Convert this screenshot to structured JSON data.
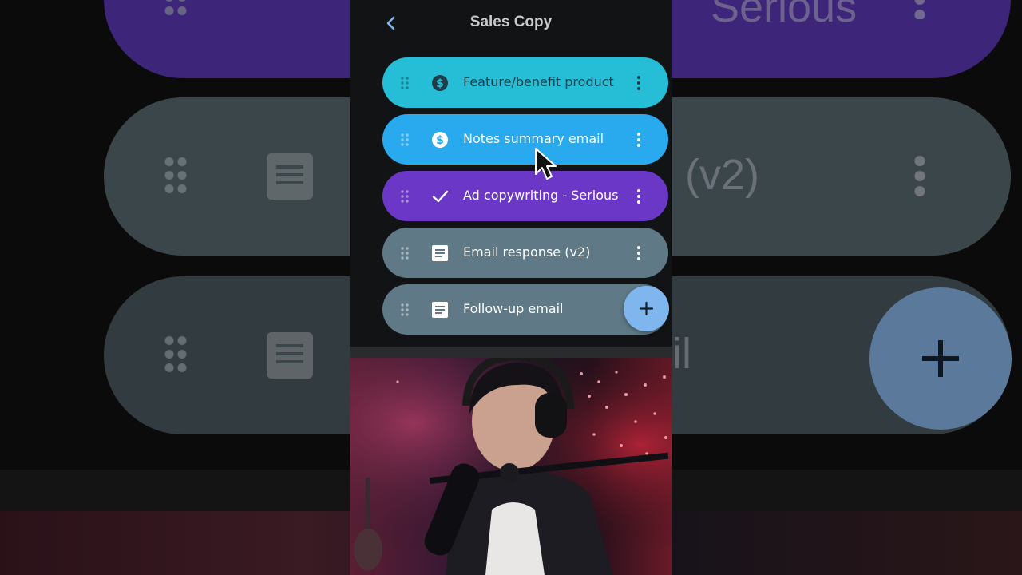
{
  "header": {
    "title": "Sales Copy"
  },
  "templates": [
    {
      "label": "Feature/benefit product",
      "icon": "dollar-circle-icon",
      "color": "#26bdd6",
      "text_color": "#1f3b44"
    },
    {
      "label": "Notes summary email",
      "icon": "dollar-circle-icon",
      "color": "#29a9ee",
      "text_color": "#ffffff"
    },
    {
      "label": "Ad copywriting - Serious",
      "icon": "check-icon",
      "color": "#6a37c6",
      "text_color": "#ffffff"
    },
    {
      "label": "Email response (v2)",
      "icon": "document-icon",
      "color": "#5f7a86",
      "text_color": "#ffffff"
    },
    {
      "label": "Follow-up email",
      "icon": "document-icon",
      "color": "#5f7a86",
      "text_color": "#ffffff"
    }
  ],
  "background": {
    "fragment_1": "Serious",
    "fragment_2": "(v2)",
    "fragment_3": "il"
  }
}
